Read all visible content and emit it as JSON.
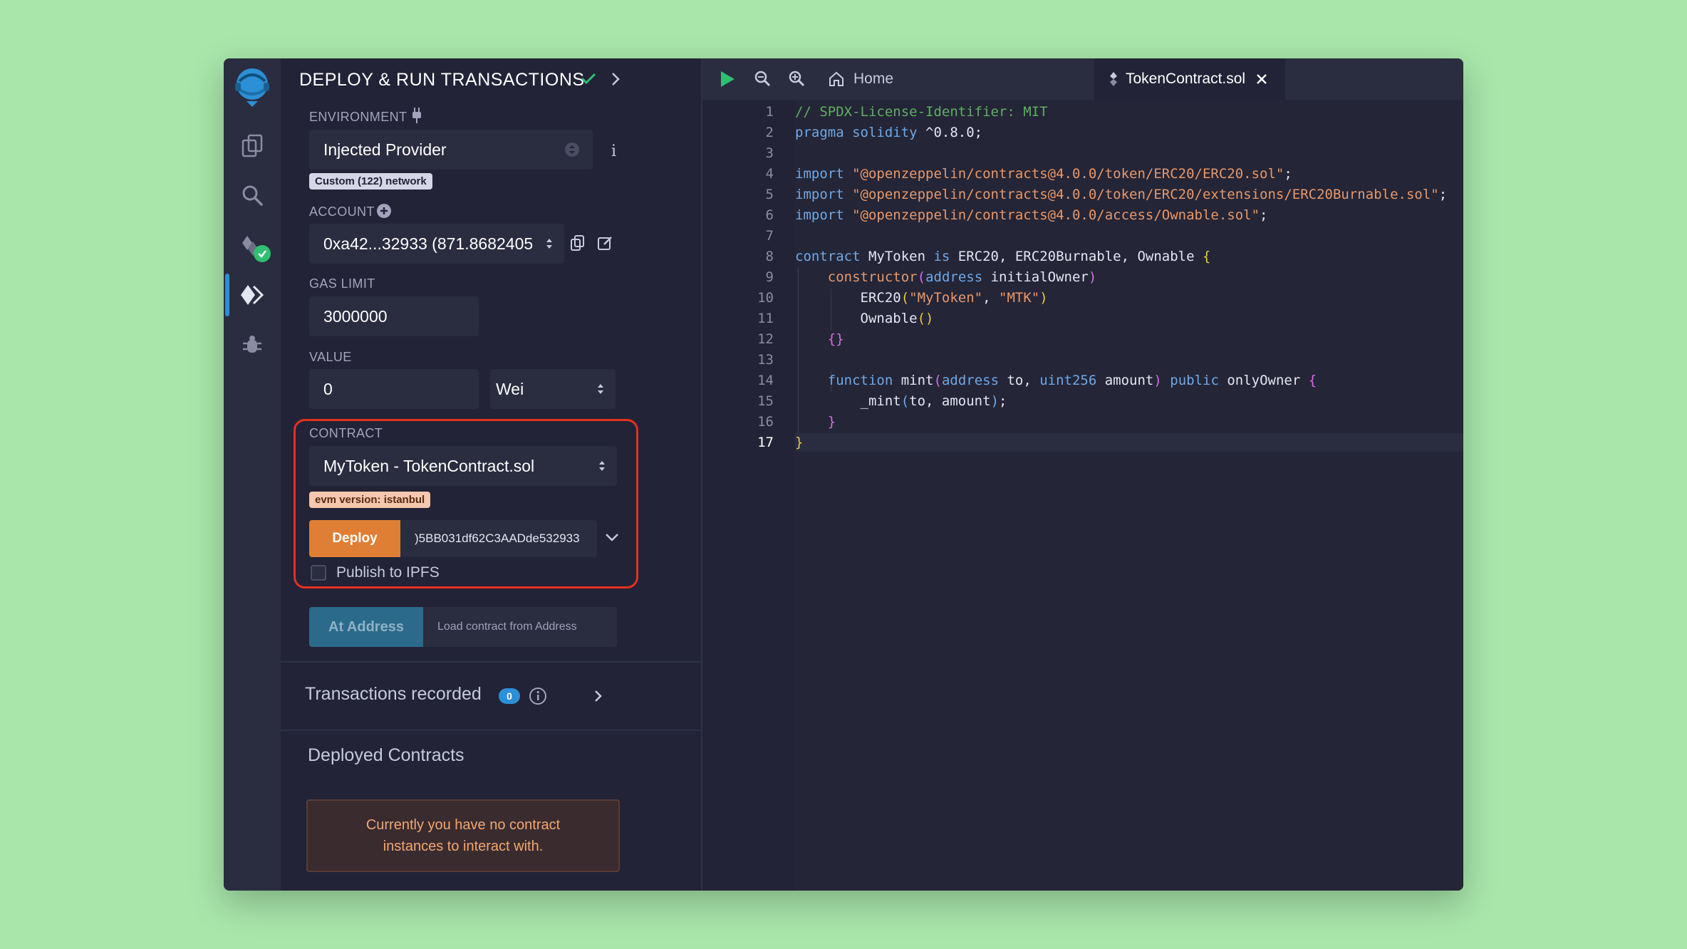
{
  "panel": {
    "title": "DEPLOY & RUN TRANSACTIONS",
    "environment": {
      "label": "ENVIRONMENT",
      "value": "Injected Provider",
      "network_tag": "Custom (122) network"
    },
    "account": {
      "label": "ACCOUNT",
      "value": "0xa42...32933 (871.8682405"
    },
    "gas_limit": {
      "label": "GAS LIMIT",
      "value": "3000000"
    },
    "value": {
      "label": "VALUE",
      "amount": "0",
      "unit": "Wei"
    },
    "contract": {
      "label": "CONTRACT",
      "value": "MyToken - TokenContract.sol",
      "evm_tag": "evm version: istanbul",
      "deploy_label": "Deploy",
      "deploy_args": ")5BB031df62C3AADde532933",
      "publish_label": "Publish to IPFS"
    },
    "at_address": {
      "button_label": "At Address",
      "placeholder": "Load contract from Address"
    },
    "transactions": {
      "label": "Transactions recorded",
      "count": "0"
    },
    "deployed": {
      "label": "Deployed Contracts",
      "empty_message": "Currently you have no contract instances to interact with."
    }
  },
  "editor": {
    "tabs": [
      {
        "label": "Home"
      },
      {
        "label": "TokenContract.sol"
      }
    ],
    "line_numbers": [
      "1",
      "2",
      "3",
      "4",
      "5",
      "6",
      "7",
      "8",
      "9",
      "10",
      "11",
      "12",
      "13",
      "14",
      "15",
      "16",
      "17"
    ],
    "current_line": "17",
    "code": {
      "l1": "// SPDX-License-Identifier: MIT",
      "l2_kw": "pragma solidity",
      "l2_rest": " ^0.8.0;",
      "import_kw": "import",
      "l4_str": "\"@openzeppelin/contracts@4.0.0/token/ERC20/ERC20.sol\"",
      "l5_str": "\"@openzeppelin/contracts@4.0.0/token/ERC20/extensions/ERC20Burnable.sol\"",
      "l6_str": "\"@openzeppelin/contracts@4.0.0/access/Ownable.sol\"",
      "semi": ";",
      "l8_kw": "contract",
      "l8_name": " MyToken ",
      "l8_is": "is",
      "l8_rest": " ERC20, ERC20Burnable, Ownable ",
      "brace_open": "{",
      "brace_close": "}",
      "l9_kw": "constructor",
      "l9_paren": "(",
      "l9_type": "address",
      "l9_rest": " initialOwner",
      "l9_close": ")",
      "l10_name": "ERC20",
      "l10_open": "(",
      "l10_s1": "\"MyToken\"",
      "l10_comma": ", ",
      "l10_s2": "\"MTK\"",
      "l10_close": ")",
      "l11_name": "Ownable",
      "l11_parens": "()",
      "l12": "{}",
      "l14_kw": "function",
      "l14_name": " mint",
      "l14_open": "(",
      "l14_t1": "address",
      "l14_a1": " to, ",
      "l14_t2": "uint256",
      "l14_a2": " amount",
      "l14_close": ")",
      "l14_pub": " public",
      "l14_mod": " onlyOwner ",
      "l15_name": "_mint",
      "l15_open": "(",
      "l15_args": "to, amount",
      "l15_close": ")"
    }
  }
}
